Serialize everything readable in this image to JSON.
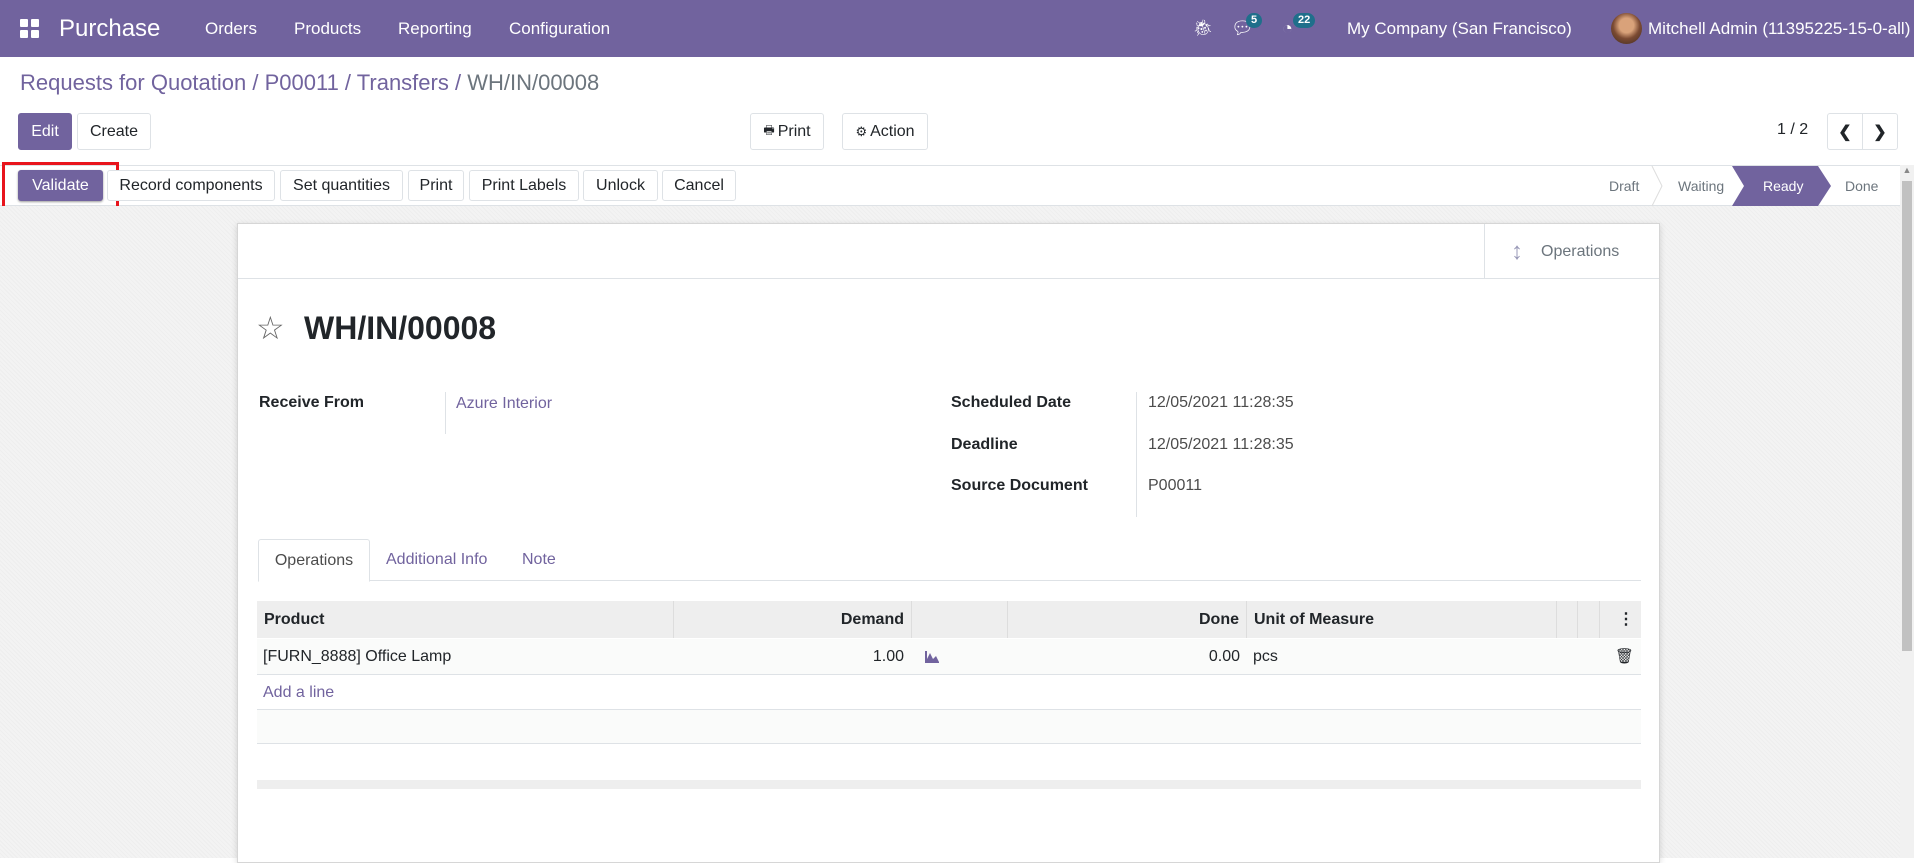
{
  "navbar": {
    "app_name": "Purchase",
    "menu": [
      "Orders",
      "Products",
      "Reporting",
      "Configuration"
    ],
    "messages_count": "5",
    "activities_count": "22",
    "company": "My Company (San Francisco)",
    "user": "Mitchell Admin (11395225-15-0-all)",
    "color": "#71639e"
  },
  "breadcrumb": [
    "Requests for Quotation",
    "P00011",
    "Transfers",
    "WH/IN/00008"
  ],
  "control": {
    "edit": "Edit",
    "create": "Create",
    "print": "Print",
    "action": "Action",
    "pager": "1 / 2"
  },
  "header_buttons": {
    "validate": "Validate",
    "record_components": "Record components",
    "set_quantities": "Set quantities",
    "print": "Print",
    "print_labels": "Print Labels",
    "unlock": "Unlock",
    "cancel": "Cancel"
  },
  "statusbar": {
    "steps": [
      "Draft",
      "Waiting",
      "Ready",
      "Done"
    ],
    "active": "Ready"
  },
  "sheet": {
    "smart_button": "Operations",
    "title": "WH/IN/00008",
    "fields": {
      "receive_from_label": "Receive From",
      "receive_from": "Azure Interior",
      "scheduled_date_label": "Scheduled Date",
      "scheduled_date": "12/05/2021 11:28:35",
      "deadline_label": "Deadline",
      "deadline": "12/05/2021 11:28:35",
      "source_document_label": "Source Document",
      "source_document": "P00011"
    },
    "tabs": [
      "Operations",
      "Additional Info",
      "Note"
    ],
    "active_tab": "Operations",
    "table": {
      "headers": {
        "product": "Product",
        "demand": "Demand",
        "done": "Done",
        "uom": "Unit of Measure"
      },
      "rows": [
        {
          "product": "[FURN_8888] Office Lamp",
          "demand": "1.00",
          "done": "0.00",
          "uom": "pcs"
        }
      ],
      "add_line": "Add a line"
    }
  }
}
